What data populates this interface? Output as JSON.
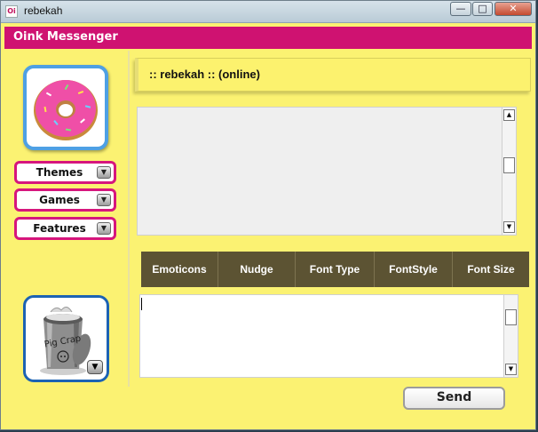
{
  "window": {
    "title": "rebekah",
    "app_icon_text": "Oi",
    "minimize_glyph": "—",
    "maximize_glyph": "□",
    "close_glyph": "✕"
  },
  "app": {
    "title": "Oink Messenger"
  },
  "sidebar": {
    "avatar_icon": "donut-avatar-icon",
    "buttons": [
      {
        "label": "Themes"
      },
      {
        "label": "Games"
      },
      {
        "label": "Features"
      }
    ],
    "dropdown_glyph": "▼",
    "trash_icon": "pig-trash-can-icon",
    "trash_text": "Pig Crap"
  },
  "status": {
    "text": ":: rebekah :: (online)"
  },
  "chat": {
    "scroll_up_glyph": "▲",
    "scroll_down_glyph": "▼"
  },
  "toolbar": {
    "buttons": [
      {
        "label": "Emoticons"
      },
      {
        "label": "Nudge"
      },
      {
        "label": "Font Type"
      },
      {
        "label": "FontStyle"
      },
      {
        "label": "Font Size"
      }
    ]
  },
  "input": {
    "value": ""
  },
  "send": {
    "label": "Send"
  },
  "colors": {
    "background": "#fbf272",
    "header": "#cf1271",
    "toolbar": "#5c5333",
    "button_border": "#d6167d",
    "avatar_border": "#4ea0e4"
  }
}
